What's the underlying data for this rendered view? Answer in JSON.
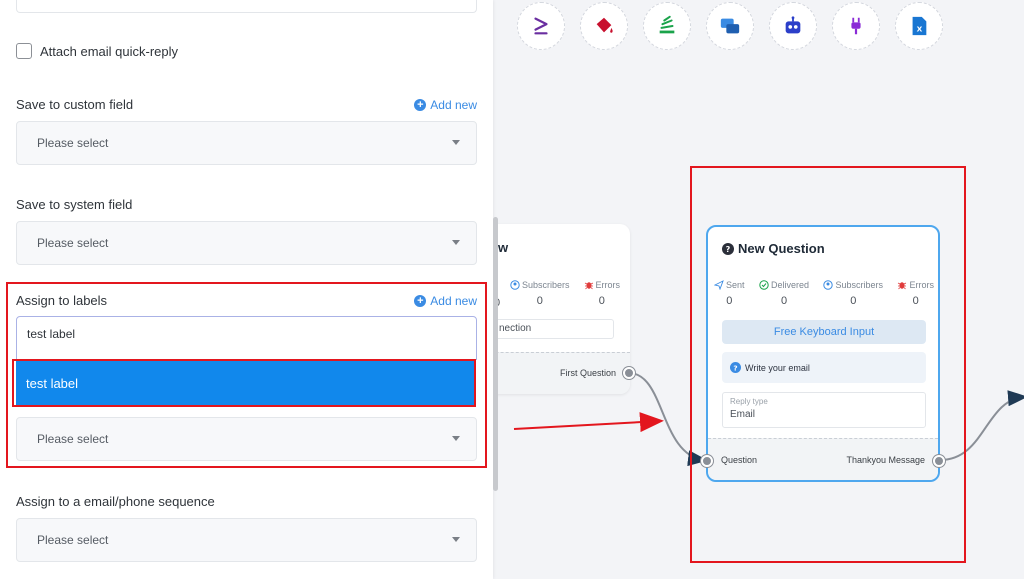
{
  "panel": {
    "attach_quick_reply": "Attach email quick-reply",
    "custom_field": {
      "label": "Save to custom field",
      "add_new": "Add new",
      "placeholder": "Please select"
    },
    "system_field": {
      "label": "Save to system field",
      "placeholder": "Please select"
    },
    "labels": {
      "label": "Assign to labels",
      "add_new": "Add new",
      "input_value": "test label",
      "option": "test label",
      "placeholder": "Please select"
    },
    "sequence": {
      "label": "Assign to a email/phone sequence",
      "placeholder": "Please select"
    }
  },
  "toolbar": {
    "icons": [
      "greater-than-equal-icon",
      "paint-bucket-icon",
      "stack-icon",
      "chat-messages-icon",
      "robot-icon",
      "plug-icon",
      "excel-file-icon"
    ]
  },
  "left_node": {
    "title_fragment": "ow",
    "stats": [
      {
        "label": "Subscribers",
        "value": "0"
      },
      {
        "label": "Errors",
        "value": "0"
      }
    ],
    "partial_value": "0",
    "connection_text": "nection",
    "output_label": "First Question"
  },
  "main_node": {
    "title": "New Question",
    "stats": [
      {
        "label": "Sent",
        "value": "0"
      },
      {
        "label": "Delivered",
        "value": "0"
      },
      {
        "label": "Subscribers",
        "value": "0"
      },
      {
        "label": "Errors",
        "value": "0"
      }
    ],
    "button": "Free Keyboard Input",
    "message": "Write your email",
    "reply_type_label": "Reply type",
    "reply_type_value": "Email",
    "input_port": "Question",
    "output_port": "Thankyou Message"
  },
  "colors": {
    "accent": "#3a8be3",
    "highlight": "#1188ec",
    "annotation_red": "#e3161e",
    "node_border": "#4ea7ee"
  }
}
